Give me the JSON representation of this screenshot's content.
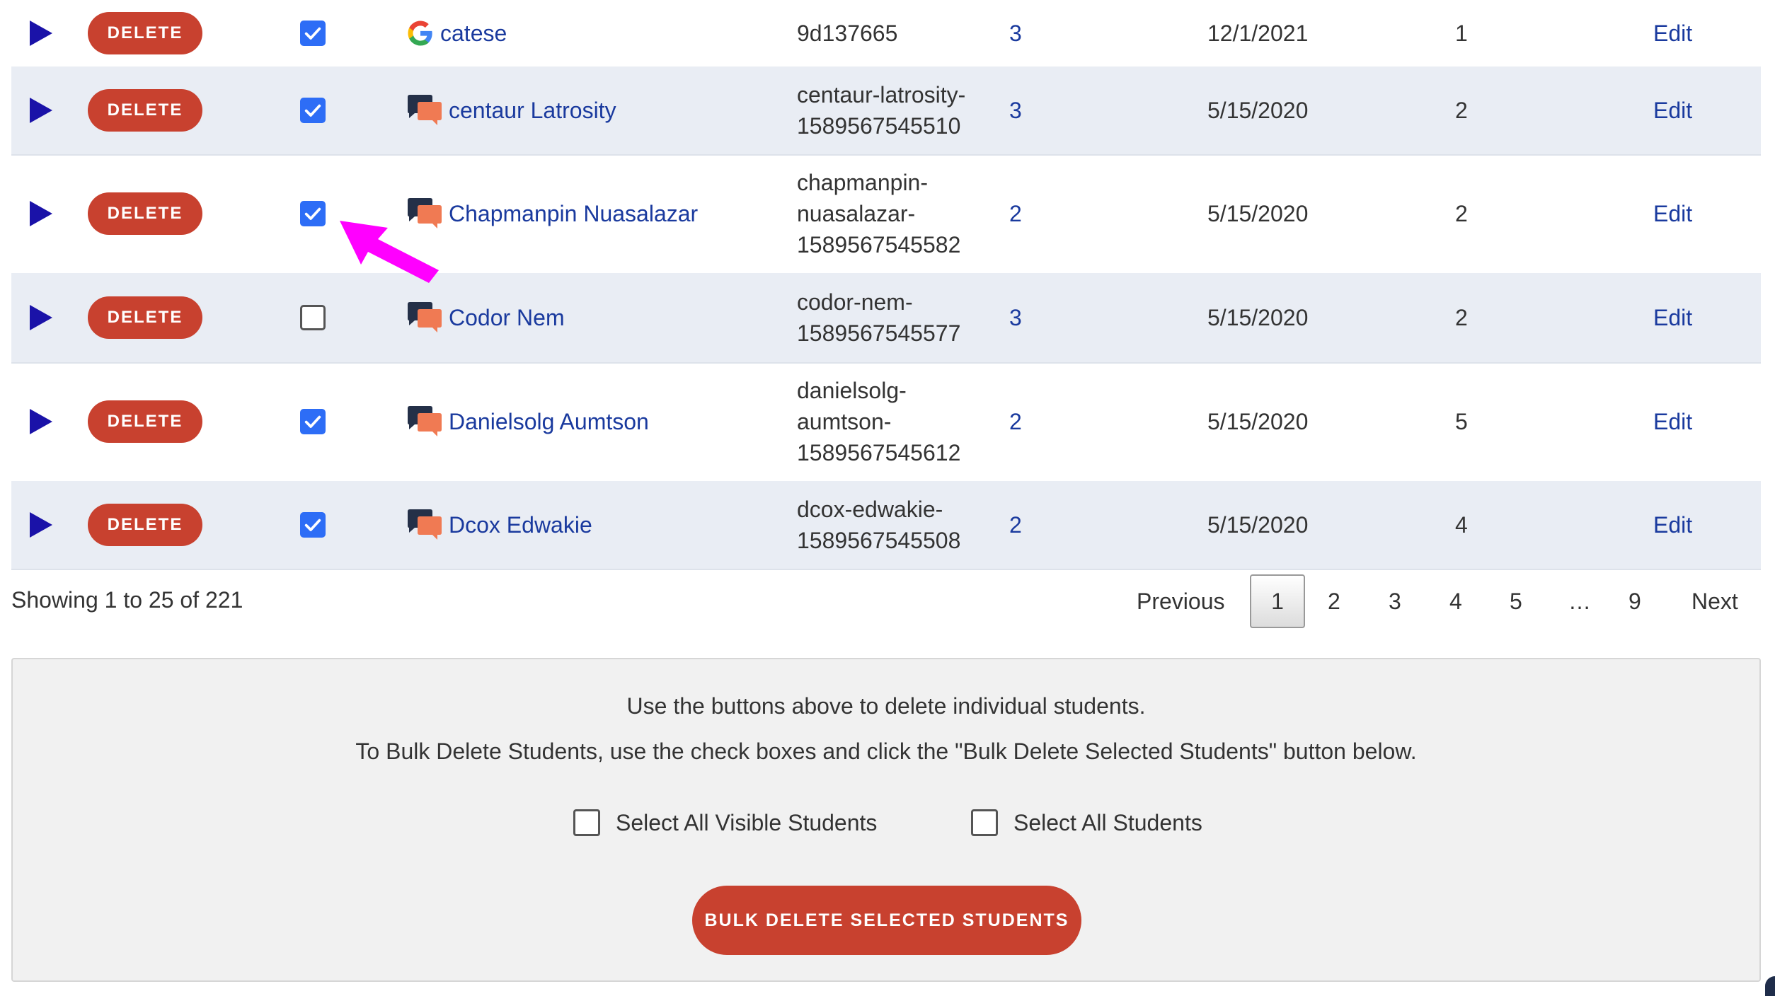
{
  "rows": [
    {
      "delete_label": "DELETE",
      "checked": true,
      "icon": "google-icon",
      "name": "catese",
      "id": "9d137665",
      "num": "3",
      "date": "12/1/2021",
      "count": "1",
      "edit": "Edit"
    },
    {
      "delete_label": "DELETE",
      "checked": true,
      "icon": "chat-icon",
      "name": "centaur Latrosity",
      "id": "centaur-latrosity-\n1589567545510",
      "num": "3",
      "date": "5/15/2020",
      "count": "2",
      "edit": "Edit"
    },
    {
      "delete_label": "DELETE",
      "checked": true,
      "icon": "chat-icon",
      "name": "Chapmanpin Nuasalazar",
      "id": "chapmanpin-\nnuasalazar-\n1589567545582",
      "num": "2",
      "date": "5/15/2020",
      "count": "2",
      "edit": "Edit"
    },
    {
      "delete_label": "DELETE",
      "checked": false,
      "icon": "chat-icon",
      "name": "Codor Nem",
      "id": "codor-nem-\n1589567545577",
      "num": "3",
      "date": "5/15/2020",
      "count": "2",
      "edit": "Edit"
    },
    {
      "delete_label": "DELETE",
      "checked": true,
      "icon": "chat-icon",
      "name": "Danielsolg Aumtson",
      "id": "danielsolg-\naumtson-\n1589567545612",
      "num": "2",
      "date": "5/15/2020",
      "count": "5",
      "edit": "Edit"
    },
    {
      "delete_label": "DELETE",
      "checked": true,
      "icon": "chat-icon",
      "name": "Dcox Edwakie",
      "id": "dcox-edwakie-\n1589567545508",
      "num": "2",
      "date": "5/15/2020",
      "count": "4",
      "edit": "Edit"
    }
  ],
  "footer": {
    "showing": "Showing 1 to 25 of 221"
  },
  "pagination": {
    "previous": "Previous",
    "current": "1",
    "pages": [
      "2",
      "3",
      "4",
      "5",
      "…",
      "9"
    ],
    "next": "Next"
  },
  "panel": {
    "line1": "Use the buttons above to delete individual students.",
    "line2": "To Bulk Delete Students, use the check boxes and click the \"Bulk Delete Selected Students\" button below.",
    "select_visible": "Select All Visible Students",
    "select_all": "Select All Students",
    "bulk_button": "BULK DELETE SELECTED STUDENTS"
  },
  "colors": {
    "delete_red": "#c8412f",
    "link_blue": "#1a3a9e",
    "checkbox_blue": "#2d6df6",
    "arrow_magenta": "#ff00ff"
  }
}
